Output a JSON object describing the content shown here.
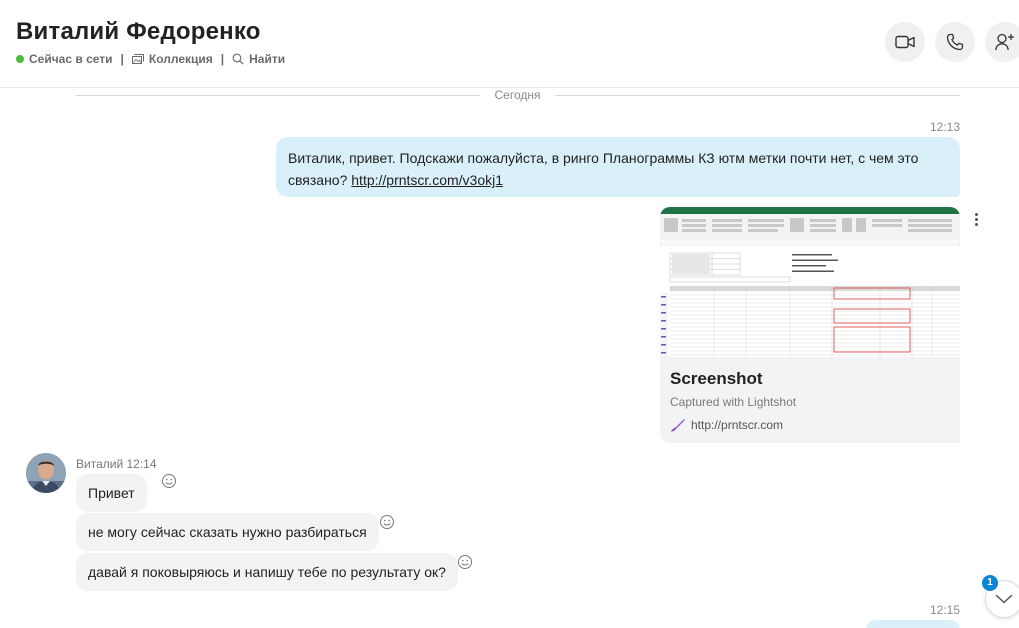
{
  "header": {
    "contact_name": "Виталий Федоренко",
    "status": "Сейчас в сети",
    "collection": "Коллекция",
    "find": "Найти",
    "separator": "|",
    "online_color": "#4cbd3c"
  },
  "chat": {
    "day_divider": "Сегодня",
    "outgoing": [
      {
        "time": "12:13",
        "text": "Виталик, привет. Подскажи пожалуйста, в ринго Планограммы КЗ ютм метки почти нет, с чем это связано? ",
        "link": "http://prntscr.com/v3okj1"
      }
    ],
    "link_preview": {
      "title": "Screenshot",
      "subtitle": "Captured with Lightshot",
      "url": "http://prntscr.com"
    },
    "incoming_group": {
      "sender": "Виталий",
      "time": "12:14",
      "messages": [
        "Привет",
        "не могу сейчас сказать нужно разбираться",
        "давай я поковыряюсь и напишу тебе по результату ок?"
      ]
    },
    "next_outgoing_time": "12:15",
    "unread_badge": "1"
  },
  "icons": {
    "video": "video-call-icon",
    "call": "phone-call-icon",
    "add_person": "add-person-icon",
    "collection": "gallery-icon",
    "search": "search-icon",
    "react": "smiley-icon",
    "scroll_down": "chevron-down-icon",
    "lightshot": "feather-icon"
  },
  "colors": {
    "outgoing_bubble": "#d9f0fb",
    "incoming_bubble": "#f2f3f5",
    "badge": "#0a84d6"
  }
}
